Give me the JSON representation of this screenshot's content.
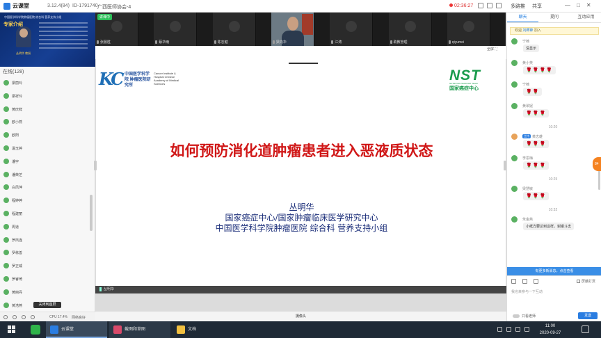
{
  "topbar": {
    "app_name": "云课堂",
    "version": "3.12.4(84)",
    "room_id": "ID-1791740",
    "room_name": "广西医师协会-4",
    "record_time": "02:36:27",
    "btn_multi": "多路推",
    "btn_share": "共享",
    "win_min": "—",
    "win_max": "□",
    "win_close": "✕"
  },
  "left": {
    "banner_title": "专家介绍",
    "banner_text": "中国医学科学院肿瘤医院 综合科 营养支持小组",
    "banner_name": "丛明华 教授",
    "online_label": "在线(128)",
    "members": [
      "梁丽玲",
      "梁祥玲",
      "黄庆鲜",
      "欧小燕",
      "欧阳",
      "温玉婷",
      "潘宇",
      "潘荣芝",
      "白凤萍",
      "程婷婷",
      "程建丽",
      "周道",
      "罗凤连",
      "罗栋善",
      "罗正威",
      "罗睿琦",
      "黄丽丹",
      "黄浩燕",
      "黄媚"
    ],
    "close_hands": "关闭到首屏",
    "cpu": "CPU 17.4%",
    "network": "网络良好"
  },
  "videos": {
    "teacher_tag": "讲课中",
    "tiles": [
      "张晨胜",
      "蔡华雨",
      "陈志健",
      "梁向华",
      "江涛",
      "助教管理",
      "qiyumei"
    ],
    "fullscreen": "全屏"
  },
  "slide": {
    "logo_cn": "中国医学科学院 肿瘤医院研究所",
    "logo_en": "Cancer Institute & Hospital Chinese Academy of Medical Sciences",
    "nst": "NST",
    "nst_sub": "NUTRITION SUPPORT TEAM",
    "nst_cn": "国家癌症中心",
    "title": "如何预防消化道肿瘤患者进入恶液质状态",
    "author_lines": [
      "丛明华",
      "国家癌症中心/国家肿瘤临床医学研究中心",
      "中国医学科学院肿瘤医院 综合科 营养支持小组"
    ],
    "speaker": "丛明华",
    "camera_label": "摄像头"
  },
  "chat": {
    "tabs": [
      "聊天",
      "提问",
      "互动应用"
    ],
    "welcome_prefix": "欢迎",
    "welcome_user": "刘卿锋",
    "welcome_suffix": "加入",
    "messages": [
      {
        "name": "宁楠",
        "text": "没显示",
        "flowers": 0
      },
      {
        "name": "黄小英",
        "text": "",
        "flowers": 4
      },
      {
        "name": "宁楠",
        "text": "",
        "flowers": 2
      },
      {
        "name": "黄翠妮",
        "text": "",
        "flowers": 3
      },
      {
        "time": "10:20"
      },
      {
        "name": "黄志雄",
        "tag": "主持",
        "text": "",
        "flowers": 3
      },
      {
        "name": "李思梅",
        "text": "",
        "flowers": 3
      },
      {
        "time": "10:25"
      },
      {
        "name": "梁慧敏",
        "text": "",
        "flowers": 3
      },
      {
        "time": "10:32"
      },
      {
        "name": "朱金燕",
        "text": "小纸方要达到这样。谢谢斗志",
        "flowers": 0
      }
    ],
    "new_msg": "有更多新消息，点击查看",
    "placeholder": "我也来参与一下互动",
    "shield": "屏蔽打赏",
    "only_teacher": "只看老师",
    "send": "发送",
    "float": "84"
  },
  "taskbar": {
    "apps": [
      "云课堂",
      "截图和草图",
      "文档"
    ],
    "time": "11:00",
    "date": "2020-09-27"
  }
}
